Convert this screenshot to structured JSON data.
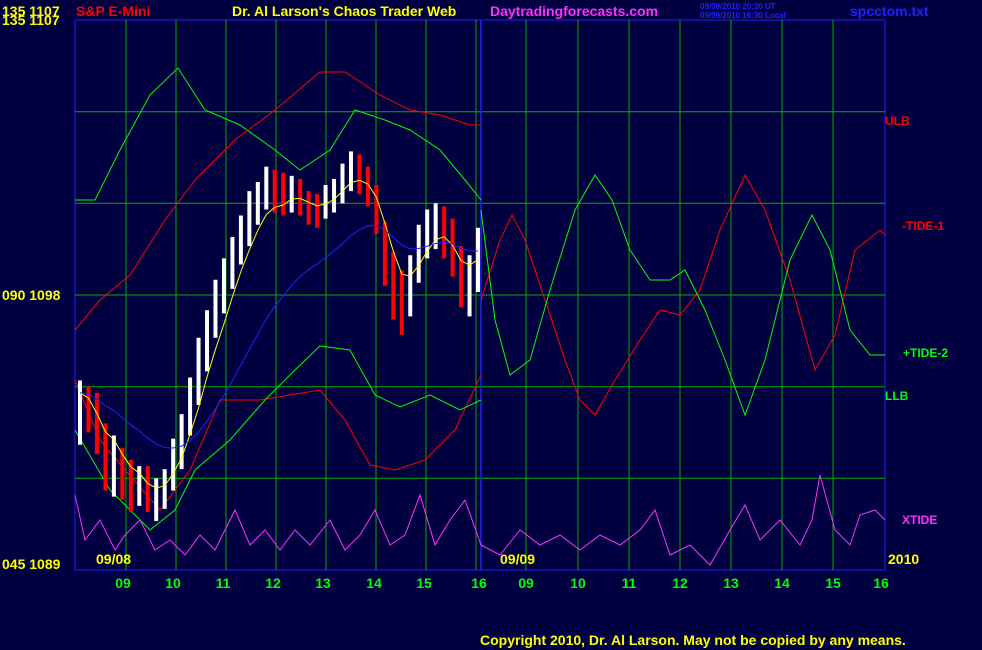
{
  "header": {
    "left_label": "135  1107",
    "instrument": "S&P E-Mini",
    "title": "Dr. Al Larson's Chaos Trader Web",
    "site": "Daytradingforecasts.com",
    "time_ut": "09/09/2010 20:30 UT",
    "time_local": "09/09/2010 16:30 Local",
    "filename": "spcctom.txt"
  },
  "copyright": "Copyright 2010, Dr. Al Larson. May not be copied by any means.",
  "colors": {
    "background": "#000040",
    "grid": "#00b000",
    "frame": "#2020ff",
    "price_up": "#ffffff",
    "price_down": "#ff0000",
    "ulb": "#ff0000",
    "llb": "#00ff00",
    "tide1": "#ff0000",
    "tide2": "#00ff00",
    "xtide": "#ff30ff",
    "fast_avg": "#ffff00",
    "slow_avg": "#2020ff"
  },
  "chart_data": {
    "type": "line",
    "y_axis": {
      "labels": [
        {
          "value": 1107,
          "text": "135  1107"
        },
        {
          "value": 1098,
          "text": "090  1098"
        },
        {
          "value": 1089,
          "text": "045  1089"
        }
      ],
      "ylim": [
        1089,
        1107
      ]
    },
    "x_axis": {
      "hour_labels": [
        "09",
        "10",
        "11",
        "12",
        "13",
        "14",
        "15",
        "16",
        "09",
        "10",
        "11",
        "12",
        "13",
        "14",
        "15",
        "16"
      ],
      "date_labels": [
        "09/08",
        "09/09"
      ],
      "year_label": "2010"
    },
    "grid": true,
    "series_labels": [
      {
        "name": "ULB",
        "color": "#ff0000"
      },
      {
        "name": "-TIDE-1",
        "color": "#ff0000"
      },
      {
        "name": "+TIDE-2",
        "color": "#00ff00"
      },
      {
        "name": "LLB",
        "color": "#00ff00"
      },
      {
        "name": "XTIDE",
        "color": "#ff30ff"
      }
    ],
    "price_hlc": [
      [
        1095.2,
        1093.1,
        1094.8
      ],
      [
        1095,
        1093.5,
        1094.3
      ],
      [
        1094.8,
        1092.8,
        1093.2
      ],
      [
        1093.8,
        1091.6,
        1092.4
      ],
      [
        1093.4,
        1091.4,
        1092.8
      ],
      [
        1093,
        1091.3,
        1091.9
      ],
      [
        1092.6,
        1090.9,
        1091.6
      ],
      [
        1092.4,
        1091.1,
        1091.8
      ],
      [
        1092.4,
        1090.9,
        1091.2
      ],
      [
        1092,
        1090.6,
        1091.4
      ],
      [
        1092.3,
        1091,
        1091.9
      ],
      [
        1093.3,
        1091.6,
        1092.9
      ],
      [
        1094.1,
        1092.3,
        1093.6
      ],
      [
        1095.3,
        1093.4,
        1094.9
      ],
      [
        1096.6,
        1094.4,
        1095.9
      ],
      [
        1097.5,
        1095.5,
        1097.2
      ],
      [
        1098.5,
        1096.6,
        1097.9
      ],
      [
        1099.2,
        1097.4,
        1098.6
      ],
      [
        1099.9,
        1098.2,
        1099.6
      ],
      [
        1100.6,
        1099,
        1100.3
      ],
      [
        1101.4,
        1099.6,
        1100.8
      ],
      [
        1101.7,
        1100.3,
        1101.3
      ],
      [
        1102.2,
        1100.8,
        1101.6
      ],
      [
        1102.1,
        1100.7,
        1101.3
      ],
      [
        1102,
        1100.6,
        1101.1
      ],
      [
        1101.9,
        1100.7,
        1101.5
      ],
      [
        1101.8,
        1100.6,
        1101.2
      ],
      [
        1101.4,
        1100.3,
        1100.8
      ],
      [
        1101.3,
        1100.2,
        1100.7
      ],
      [
        1101.6,
        1100.5,
        1101.1
      ],
      [
        1101.8,
        1100.7,
        1101.4
      ],
      [
        1102.3,
        1101,
        1101.9
      ],
      [
        1102.7,
        1101.4,
        1102.2
      ],
      [
        1102.6,
        1101.3,
        1101.9
      ],
      [
        1102.2,
        1100.9,
        1101.4
      ],
      [
        1101.6,
        1100,
        1100.4
      ],
      [
        1100.4,
        1098.3,
        1098.8
      ],
      [
        1099.4,
        1097.2,
        1097.7
      ],
      [
        1098.8,
        1096.7,
        1097.3
      ],
      [
        1099.3,
        1097.3,
        1098.5
      ],
      [
        1100.3,
        1098.4,
        1099.6
      ],
      [
        1100.8,
        1099.2,
        1100.3
      ],
      [
        1101,
        1099.5,
        1100.5
      ],
      [
        1100.9,
        1099.2,
        1100.1
      ],
      [
        1100.5,
        1098.6,
        1099.1
      ],
      [
        1099.6,
        1097.6,
        1098.2
      ],
      [
        1099.3,
        1097.3,
        1098.7
      ],
      [
        1100.2,
        1098.1,
        1099.5
      ]
    ]
  }
}
